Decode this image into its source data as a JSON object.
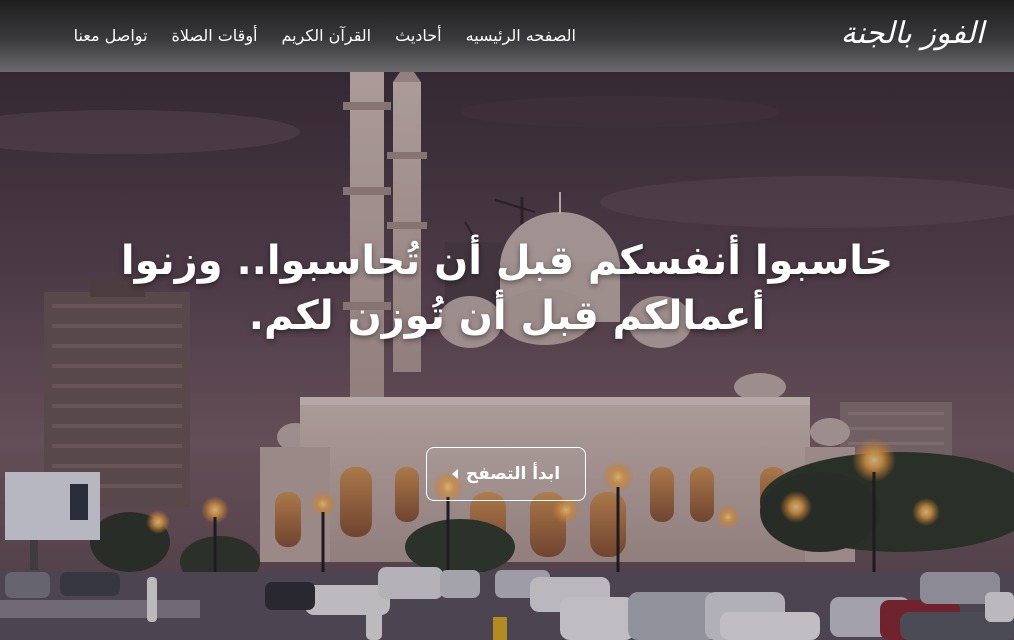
{
  "site": {
    "logo_text": "الفوز بالجنة"
  },
  "nav": {
    "items": [
      {
        "label": "الصفحه الرئيسيه"
      },
      {
        "label": "أحاديث"
      },
      {
        "label": "القرآن الكريم"
      },
      {
        "label": "أوقات الصلاة"
      },
      {
        "label": "تواصل معنا"
      }
    ]
  },
  "hero": {
    "headline": "حَاسبوا أنفسكم قبل أن تُحاسبوا.. وزنوا أعمالكم قبل أن تُوزن لكم.",
    "cta_label": "ابدأ التصفح",
    "cta_icon": "chevron-left-icon",
    "background_image": "mosque-at-dusk-photo"
  },
  "colors": {
    "header_top": "#1e1e1f",
    "header_bottom": "#6b6b6d",
    "text": "#ffffff"
  }
}
